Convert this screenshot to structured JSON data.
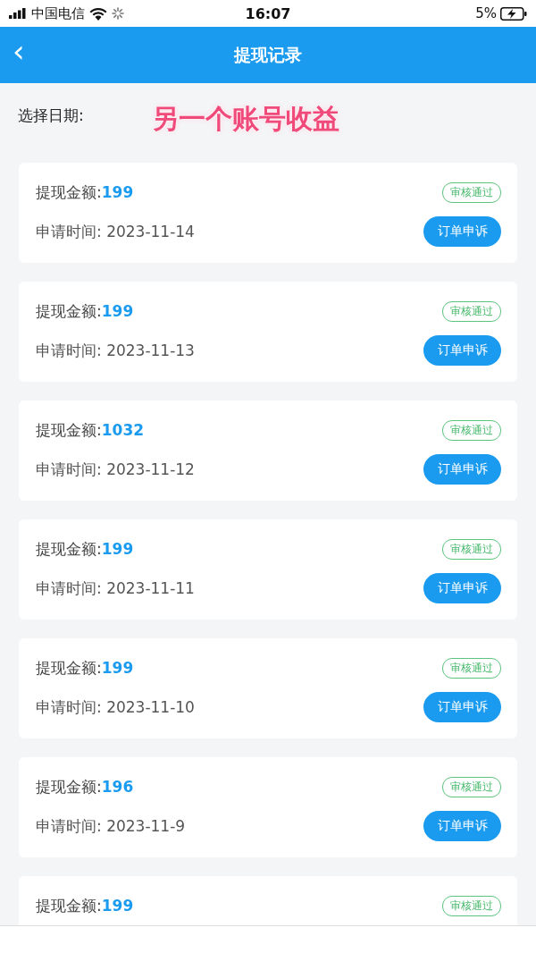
{
  "status_bar": {
    "carrier": "中国电信",
    "time": "16:07",
    "battery": "5%"
  },
  "header": {
    "back": "‹",
    "title": "提现记录"
  },
  "filter": {
    "label": "选择日期:"
  },
  "annotation": "另一个账号收益",
  "records": [
    {
      "amount_label": "提现金额:",
      "amount": "199",
      "status": "审核通过",
      "date_label": "申请时间:",
      "date": "2023-11-14",
      "action": "订单申诉"
    },
    {
      "amount_label": "提现金额:",
      "amount": "199",
      "status": "审核通过",
      "date_label": "申请时间:",
      "date": "2023-11-13",
      "action": "订单申诉"
    },
    {
      "amount_label": "提现金额:",
      "amount": "1032",
      "status": "审核通过",
      "date_label": "申请时间:",
      "date": "2023-11-12",
      "action": "订单申诉"
    },
    {
      "amount_label": "提现金额:",
      "amount": "199",
      "status": "审核通过",
      "date_label": "申请时间:",
      "date": "2023-11-11",
      "action": "订单申诉"
    },
    {
      "amount_label": "提现金额:",
      "amount": "199",
      "status": "审核通过",
      "date_label": "申请时间:",
      "date": "2023-11-10",
      "action": "订单申诉"
    },
    {
      "amount_label": "提现金额:",
      "amount": "196",
      "status": "审核通过",
      "date_label": "申请时间:",
      "date": "2023-11-9",
      "action": "订单申诉"
    },
    {
      "amount_label": "提现金额:",
      "amount": "199",
      "status": "审核通过"
    }
  ]
}
